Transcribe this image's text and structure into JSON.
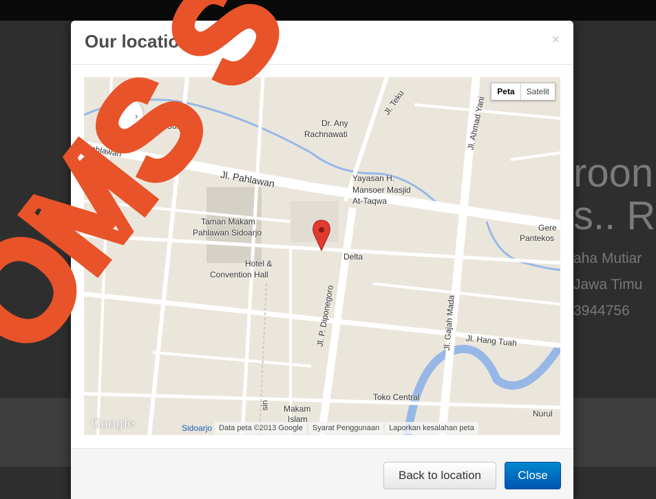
{
  "modal": {
    "title": "Our location",
    "close_symbol": "×",
    "footer": {
      "back_label": "Back to location",
      "close_label": "Close"
    }
  },
  "background": {
    "heading_line1": "roon",
    "heading_line2": "s.. R",
    "address_line1": "aha Mutiar",
    "address_line2": "Jawa Timu",
    "phone": "3944756"
  },
  "map": {
    "type_buttons": [
      "Peta",
      "Satelit"
    ],
    "labels": [
      "The Sun",
      "Dr. Any",
      "Rachnawati",
      "Jl. Teku",
      "Jl. Ahmad Yani",
      "Pahlawan",
      "Jl. Pahlawan",
      "Yayasan H.",
      "Mansoer Masjid",
      "At-Taqwa",
      "Taman Makam",
      "Pahlawan Sidoarjo",
      "Gere",
      "Pantekos",
      "Hotel &",
      "Convention Hall",
      "Delta",
      "Jl. P. Diponegoro",
      "Jl. Gajah Mada",
      "Jl. Hang Tuah",
      "Toko Central",
      "Makam",
      "Islam",
      "Nurul",
      "sin"
    ],
    "google_logo": "Google",
    "city": "Sidoarjo",
    "data_credit": "Data peta ©2013 Google",
    "terms": "Syarat Penggunaan",
    "report": "Laporkan kesalahan peta",
    "colors": {
      "road": "#ffffff",
      "block": "#e8e3d9",
      "water": "#97b8e6",
      "park": "#d6d1c6",
      "marker": "#e13a2f"
    }
  },
  "watermark": {
    "text": "OMS S",
    "color": "#e8532a"
  },
  "colors": {
    "primary": "#0066cc",
    "page_bg": "#2e2e2e"
  }
}
